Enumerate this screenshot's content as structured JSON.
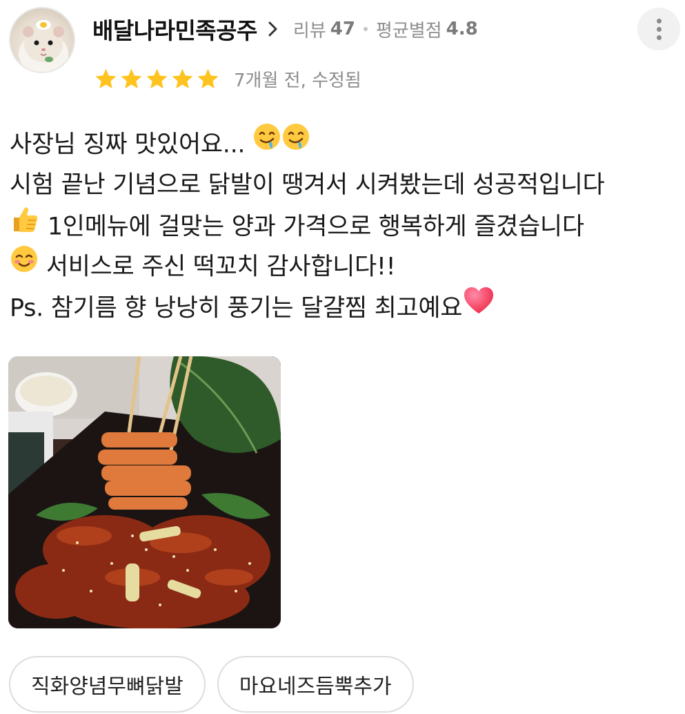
{
  "review": {
    "author": "배달나라민족공주",
    "review_label": "리뷰",
    "review_count": "47",
    "avg_label": "평균별점",
    "avg_rating": "4.8",
    "rating": 5,
    "max_rating": 5,
    "date": "7개월 전, 수정됨",
    "lines": [
      {
        "text": "사장님 징짜 맛있어요...",
        "emoji_before": "",
        "emoji_after": "drooling-face-icon x2"
      },
      {
        "text": "시험 끝난 기념으로 닭발이 땡겨서 시켜봤는데 성공적입니다",
        "emoji_before": "",
        "emoji_after": ""
      },
      {
        "text": " 1인메뉴에 걸맞는 양과 가격으로 행복하게 즐겼습니다",
        "emoji_before": "thumbs-up-icon",
        "emoji_after": ""
      },
      {
        "text": " 서비스로 주신 떡꼬치 감사합니다!!",
        "emoji_before": "smiling-blush-face-icon",
        "emoji_after": ""
      },
      {
        "text": "Ps. 참기름 향 낭낭히 풍기는 달걀찜 최고예요",
        "emoji_before": "",
        "emoji_after": "heart-icon"
      }
    ],
    "photo_icon": "food-photo-spicy-chicken-feet-with-tteok-skewers",
    "tags": [
      "직화양념무뼈닭발",
      "마요네즈듬뿍추가"
    ]
  },
  "colors": {
    "star": "#FFC31F",
    "text": "#1a1a1a",
    "meta": "#8e8e8e",
    "tag_border": "#dcdcdc"
  }
}
